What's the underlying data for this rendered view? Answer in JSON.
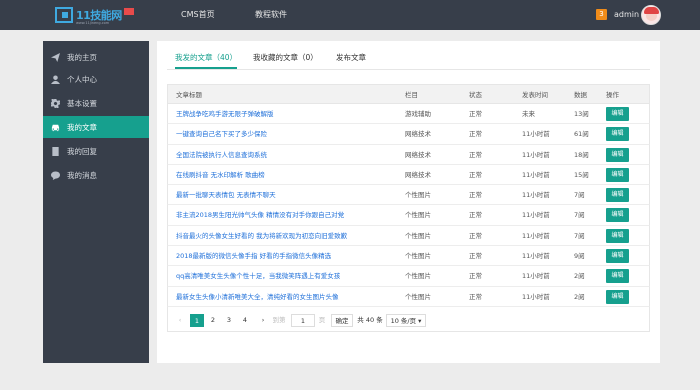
{
  "header": {
    "logo_text": "11技能网",
    "logo_sub": "www.11jineng.com",
    "nav": [
      "CMS首页",
      "教程软件"
    ],
    "notification_count": "3",
    "username": "admin"
  },
  "sidebar": {
    "items": [
      {
        "label": "我的主页",
        "icon": "send-icon"
      },
      {
        "label": "个人中心",
        "icon": "user-icon"
      },
      {
        "label": "基本设置",
        "icon": "gear-icon"
      },
      {
        "label": "我的文章",
        "icon": "car-icon",
        "active": true
      },
      {
        "label": "我的回复",
        "icon": "document-icon"
      },
      {
        "label": "我的消息",
        "icon": "chat-icon"
      }
    ]
  },
  "tabs": [
    {
      "label": "我发的文章（40）",
      "active": true
    },
    {
      "label": "我收藏的文章（0）"
    },
    {
      "label": "发布文章"
    }
  ],
  "table": {
    "headers": [
      "文章标题",
      "栏目",
      "状态",
      "发表时间",
      "数据",
      "操作"
    ],
    "rows": [
      {
        "title": "王牌战争吃鸡手游无限子弹破解版",
        "column": "游戏辅助",
        "status": "正常",
        "time": "未来",
        "data": "13阅",
        "action": "编辑"
      },
      {
        "title": "一键查询自己名下买了多少保险",
        "column": "网络技术",
        "status": "正常",
        "time": "11小时前",
        "data": "61阅",
        "action": "编辑"
      },
      {
        "title": "全国法院被执行人信息查询系统",
        "column": "网络技术",
        "status": "正常",
        "time": "11小时前",
        "data": "18阅",
        "action": "编辑"
      },
      {
        "title": "在线刷抖音 无水印解析 歌曲榜",
        "column": "网络技术",
        "status": "正常",
        "time": "11小时前",
        "data": "15阅",
        "action": "编辑"
      },
      {
        "title": "最新一批聊天表情包 无表情不聊天",
        "column": "个性图片",
        "status": "正常",
        "time": "11小时前",
        "data": "7阅",
        "action": "编辑"
      },
      {
        "title": "非主流2018男生阳光帅气头像 精情没有对手你跟自己对党",
        "column": "个性图片",
        "status": "正常",
        "time": "11小时前",
        "data": "7阅",
        "action": "编辑"
      },
      {
        "title": "抖音最火的头像女生好看的 我为将新欢现为初恋向旧爱致歉",
        "column": "个性图片",
        "status": "正常",
        "time": "11小时前",
        "data": "7阅",
        "action": "编辑"
      },
      {
        "title": "2018最新版的微信头像手指 好看的手指微信头像精选",
        "column": "个性图片",
        "status": "正常",
        "time": "11小时前",
        "data": "9阅",
        "action": "编辑"
      },
      {
        "title": "qq高清唯美女生头像个性十足，当我微笑阵遇上有爱女孩",
        "column": "个性图片",
        "status": "正常",
        "time": "11小时前",
        "data": "2阅",
        "action": "编辑"
      },
      {
        "title": "最新女生头像小清新唯美大全，清纯好看的女生图片头像",
        "column": "个性图片",
        "status": "正常",
        "time": "11小时前",
        "data": "2阅",
        "action": "编辑"
      }
    ]
  },
  "pagination": {
    "prev": "‹",
    "pages": [
      "1",
      "2",
      "3",
      "4"
    ],
    "next": "›",
    "goto_prefix": "到第",
    "goto_value": "1",
    "goto_suffix": "页",
    "confirm": "确定",
    "total": "共 40 条",
    "per_page": "10 条/页"
  },
  "colors": {
    "accent": "#16a08e",
    "topbar": "#373e4a",
    "link": "#1e6fd9",
    "badge": "#f08c1a"
  }
}
